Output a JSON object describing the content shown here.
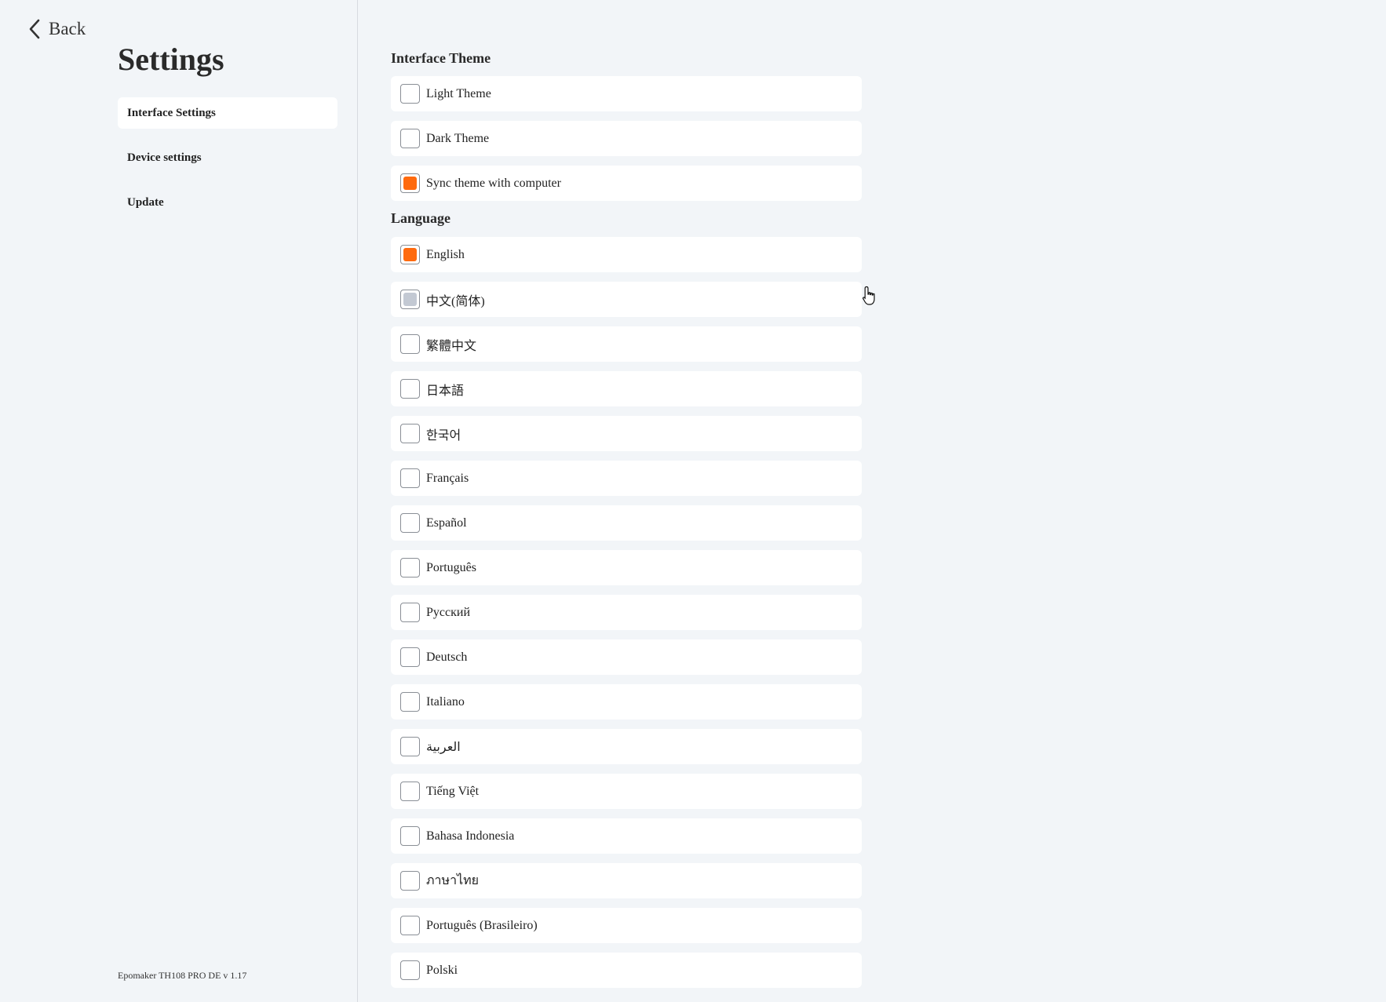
{
  "back_label": "Back",
  "title": "Settings",
  "nav": [
    {
      "label": "Interface Settings",
      "active": true
    },
    {
      "label": "Device settings",
      "active": false
    },
    {
      "label": "Update",
      "active": false
    }
  ],
  "version": "Epomaker TH108 PRO DE v 1.17",
  "theme_section": {
    "title": "Interface Theme",
    "options": [
      {
        "label": "Light Theme",
        "state": "unchecked"
      },
      {
        "label": "Dark Theme",
        "state": "unchecked"
      },
      {
        "label": "Sync theme with computer",
        "state": "checked"
      }
    ]
  },
  "language_section": {
    "title": "Language",
    "options": [
      {
        "label": "English",
        "state": "checked"
      },
      {
        "label": "中文(简体)",
        "state": "hover"
      },
      {
        "label": "繁體中文",
        "state": "unchecked"
      },
      {
        "label": "日本語",
        "state": "unchecked"
      },
      {
        "label": "한국어",
        "state": "unchecked"
      },
      {
        "label": "Français",
        "state": "unchecked"
      },
      {
        "label": "Español",
        "state": "unchecked"
      },
      {
        "label": "Português",
        "state": "unchecked"
      },
      {
        "label": "Русский",
        "state": "unchecked"
      },
      {
        "label": "Deutsch",
        "state": "unchecked"
      },
      {
        "label": "Italiano",
        "state": "unchecked"
      },
      {
        "label": "العربية",
        "state": "unchecked"
      },
      {
        "label": "Tiếng Việt",
        "state": "unchecked"
      },
      {
        "label": "Bahasa Indonesia",
        "state": "unchecked"
      },
      {
        "label": "ภาษาไทย",
        "state": "unchecked"
      },
      {
        "label": "Português (Brasileiro)",
        "state": "unchecked"
      },
      {
        "label": "Polski",
        "state": "unchecked"
      }
    ]
  },
  "colors": {
    "accent": "#ff6a0e",
    "hover_fill": "#c3c9d3",
    "background": "#f2f5f8",
    "card": "#ffffff"
  }
}
